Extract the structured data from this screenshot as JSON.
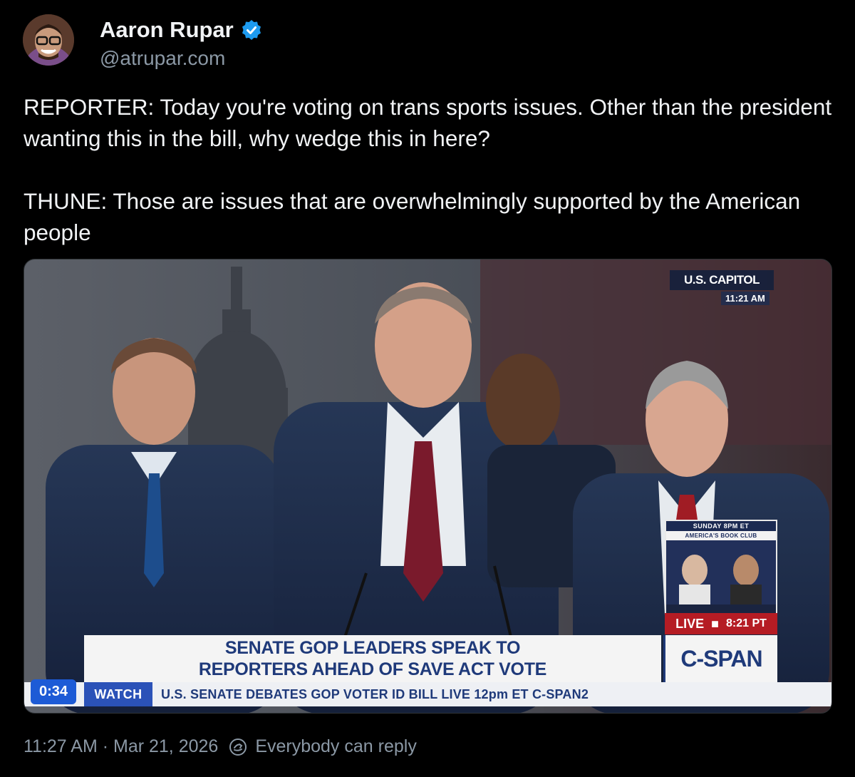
{
  "author": {
    "display_name": "Aaron Rupar",
    "handle": "@atrupar.com",
    "verified": true,
    "verified_color": "#1d9bf0"
  },
  "post": {
    "paragraphs": [
      "REPORTER: Today you're voting on trans sports issues. Other than the president wanting this in the bill, why wedge this in here?",
      "THUNE: Those are issues that are overwhelmingly supported by the American people"
    ]
  },
  "video": {
    "duration_badge": "0:34",
    "bug_label": "U.S. CAPITOL",
    "bug_time": "11:21 AM",
    "promo_top": "SUNDAY 8PM ET",
    "promo_sub": "AMERICA'S BOOK CLUB",
    "live_label": "LIVE",
    "live_time": "8:21 PT",
    "headline_line1": "SENATE GOP LEADERS SPEAK TO",
    "headline_line2": "REPORTERS AHEAD OF SAVE ACT VOTE",
    "network_logo": "C-SPAN",
    "ticker_label": "WATCH",
    "ticker_text": "U.S. SENATE DEBATES GOP VOTER ID BILL  LIVE 12pm ET  C-SPAN2"
  },
  "footer": {
    "timestamp": "11:27 AM · Mar 21, 2026",
    "reply_setting": "Everybody can reply"
  }
}
